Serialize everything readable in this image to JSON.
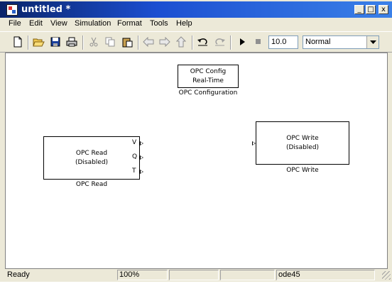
{
  "window": {
    "title": "untitled *"
  },
  "titlebar_buttons": {
    "minimize": "_",
    "maximize": "□",
    "close": "x"
  },
  "menu": [
    "File",
    "Edit",
    "View",
    "Simulation",
    "Format",
    "Tools",
    "Help"
  ],
  "toolbar": {
    "icons": [
      "new-icon",
      "open-icon",
      "save-icon",
      "print-icon",
      "cut-icon",
      "copy-icon",
      "paste-icon",
      "back-icon",
      "forward-icon",
      "up-icon",
      "undo-icon",
      "redo-icon",
      "start-simulation-icon",
      "stop-simulation-icon"
    ],
    "stop_time": "10.0",
    "sim_mode": "Normal"
  },
  "blocks": {
    "opc_config": {
      "line1": "OPC Config",
      "line2": "Real-Time",
      "label": "OPC Configuration"
    },
    "opc_read": {
      "line1": "OPC Read",
      "line2": "(Disabled)",
      "label": "OPC Read",
      "ports": [
        "V",
        "Q",
        "T"
      ]
    },
    "opc_write": {
      "line1": "OPC Write",
      "line2": "(Disabled)",
      "label": "OPC Write"
    }
  },
  "status": {
    "state": "Ready",
    "zoom": "100%",
    "p3": "",
    "p4": "",
    "solver": "ode45"
  },
  "colors": {
    "title_bar": "#1c4fd1",
    "chrome": "#ece9d8",
    "canvas": "#ffffff"
  }
}
